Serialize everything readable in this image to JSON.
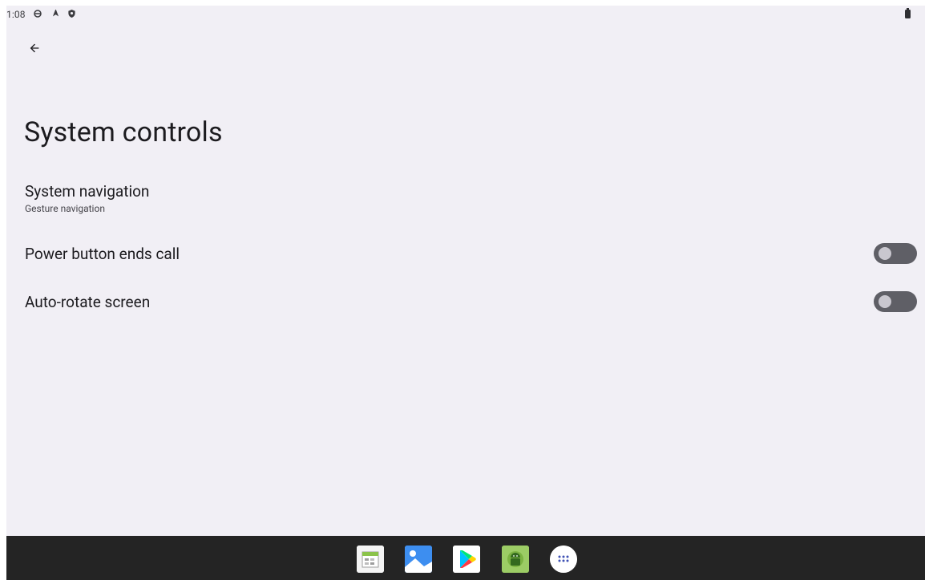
{
  "status_bar": {
    "time": "1:08",
    "icons": [
      "settings-gear-icon",
      "location-arrow-icon",
      "shield-icon",
      "battery-icon"
    ]
  },
  "header": {
    "back_icon": "arrow-back-icon",
    "title": "System controls"
  },
  "settings": [
    {
      "title": "System navigation",
      "summary": "Gesture navigation",
      "has_toggle": false
    },
    {
      "title": "Power button ends call",
      "summary": "",
      "has_toggle": true,
      "toggle_on": false
    },
    {
      "title": "Auto-rotate screen",
      "summary": "",
      "has_toggle": true,
      "toggle_on": false
    }
  ],
  "taskbar": {
    "apps": [
      "calendar-app-icon",
      "gallery-app-icon",
      "play-store-icon",
      "android-app-icon",
      "all-apps-icon"
    ]
  },
  "colors": {
    "background": "#f1eff5",
    "taskbar": "#242424",
    "toggle_track_off": "#5f5f66",
    "toggle_thumb_off": "#c9c7cf"
  }
}
